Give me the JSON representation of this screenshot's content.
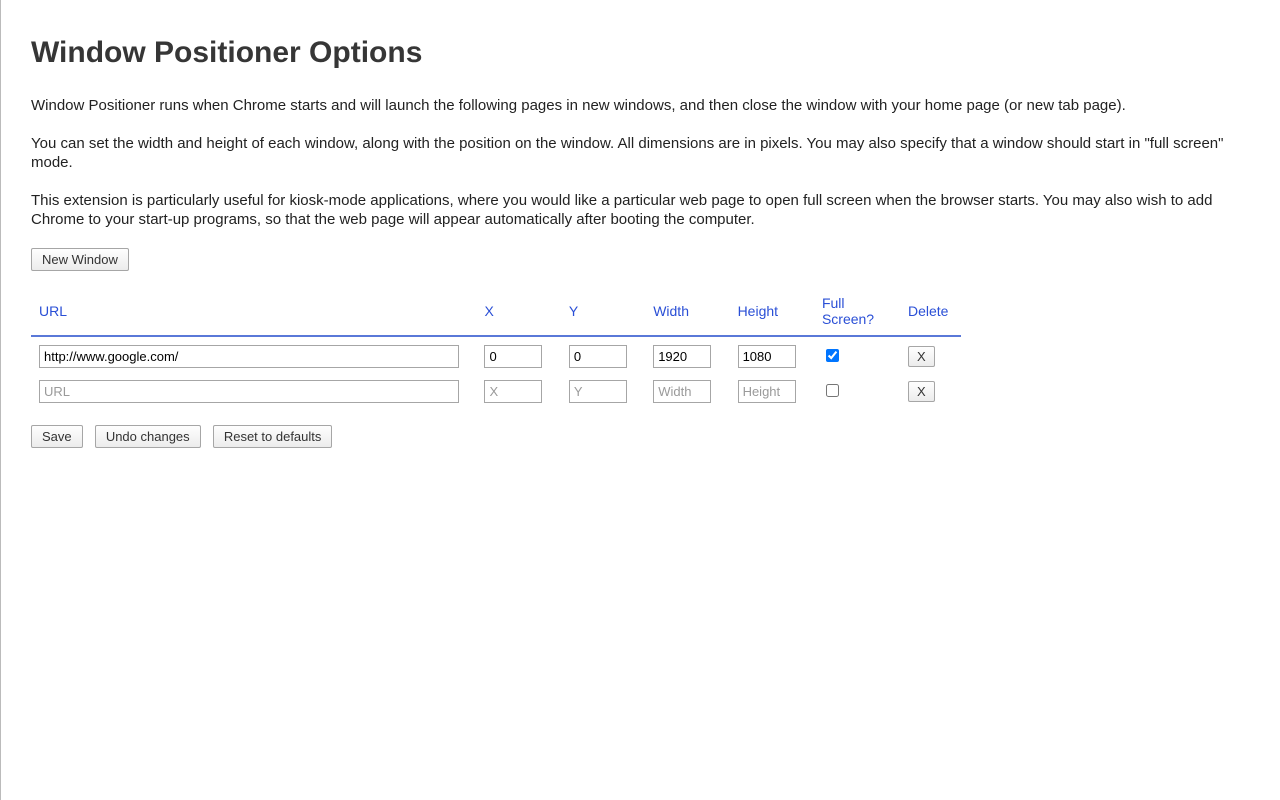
{
  "title": "Window Positioner Options",
  "paragraphs": [
    "Window Positioner runs when Chrome starts and will launch the following pages in new windows, and then close the window with your home page (or new tab page).",
    "You can set the width and height of each window, along with the position on the window. All dimensions are in pixels. You may also specify that a window should start in \"full screen\" mode.",
    "This extension is particularly useful for kiosk-mode applications, where you would like a particular web page to open full screen when the browser starts. You may also wish to add Chrome to your start-up programs, so that the web page will appear automatically after booting the computer."
  ],
  "buttons": {
    "new_window": "New Window",
    "save": "Save",
    "undo": "Undo changes",
    "reset": "Reset to defaults",
    "delete": "X"
  },
  "headers": {
    "url": "URL",
    "x": "X",
    "y": "Y",
    "width": "Width",
    "height": "Height",
    "fullscreen": "Full Screen?",
    "delete": "Delete"
  },
  "placeholders": {
    "url": "URL",
    "x": "X",
    "y": "Y",
    "width": "Width",
    "height": "Height"
  },
  "rows": [
    {
      "url": "http://www.google.com/",
      "x": "0",
      "y": "0",
      "width": "1920",
      "height": "1080",
      "fullscreen": true
    },
    {
      "url": "",
      "x": "",
      "y": "",
      "width": "",
      "height": "",
      "fullscreen": false
    }
  ]
}
